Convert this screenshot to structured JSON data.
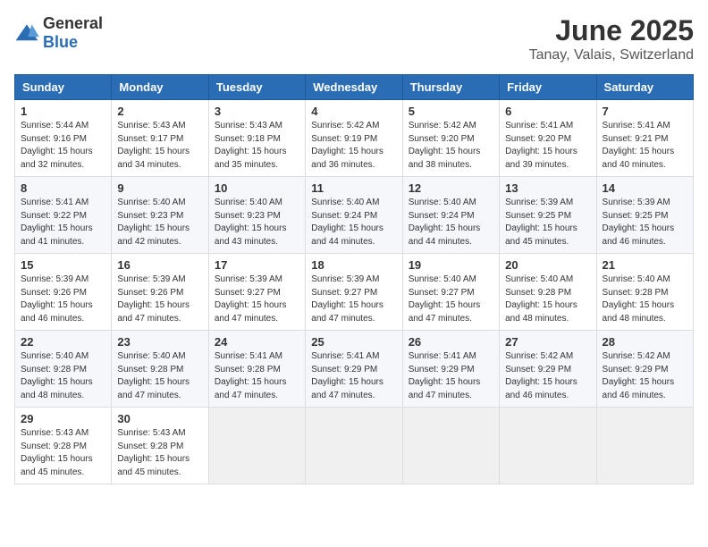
{
  "logo": {
    "text_general": "General",
    "text_blue": "Blue"
  },
  "title": "June 2025",
  "subtitle": "Tanay, Valais, Switzerland",
  "days_of_week": [
    "Sunday",
    "Monday",
    "Tuesday",
    "Wednesday",
    "Thursday",
    "Friday",
    "Saturday"
  ],
  "weeks": [
    [
      {
        "day": "1",
        "sunrise": "5:44 AM",
        "sunset": "9:16 PM",
        "daylight": "15 hours and 32 minutes."
      },
      {
        "day": "2",
        "sunrise": "5:43 AM",
        "sunset": "9:17 PM",
        "daylight": "15 hours and 34 minutes."
      },
      {
        "day": "3",
        "sunrise": "5:43 AM",
        "sunset": "9:18 PM",
        "daylight": "15 hours and 35 minutes."
      },
      {
        "day": "4",
        "sunrise": "5:42 AM",
        "sunset": "9:19 PM",
        "daylight": "15 hours and 36 minutes."
      },
      {
        "day": "5",
        "sunrise": "5:42 AM",
        "sunset": "9:20 PM",
        "daylight": "15 hours and 38 minutes."
      },
      {
        "day": "6",
        "sunrise": "5:41 AM",
        "sunset": "9:20 PM",
        "daylight": "15 hours and 39 minutes."
      },
      {
        "day": "7",
        "sunrise": "5:41 AM",
        "sunset": "9:21 PM",
        "daylight": "15 hours and 40 minutes."
      }
    ],
    [
      {
        "day": "8",
        "sunrise": "5:41 AM",
        "sunset": "9:22 PM",
        "daylight": "15 hours and 41 minutes."
      },
      {
        "day": "9",
        "sunrise": "5:40 AM",
        "sunset": "9:23 PM",
        "daylight": "15 hours and 42 minutes."
      },
      {
        "day": "10",
        "sunrise": "5:40 AM",
        "sunset": "9:23 PM",
        "daylight": "15 hours and 43 minutes."
      },
      {
        "day": "11",
        "sunrise": "5:40 AM",
        "sunset": "9:24 PM",
        "daylight": "15 hours and 44 minutes."
      },
      {
        "day": "12",
        "sunrise": "5:40 AM",
        "sunset": "9:24 PM",
        "daylight": "15 hours and 44 minutes."
      },
      {
        "day": "13",
        "sunrise": "5:39 AM",
        "sunset": "9:25 PM",
        "daylight": "15 hours and 45 minutes."
      },
      {
        "day": "14",
        "sunrise": "5:39 AM",
        "sunset": "9:25 PM",
        "daylight": "15 hours and 46 minutes."
      }
    ],
    [
      {
        "day": "15",
        "sunrise": "5:39 AM",
        "sunset": "9:26 PM",
        "daylight": "15 hours and 46 minutes."
      },
      {
        "day": "16",
        "sunrise": "5:39 AM",
        "sunset": "9:26 PM",
        "daylight": "15 hours and 47 minutes."
      },
      {
        "day": "17",
        "sunrise": "5:39 AM",
        "sunset": "9:27 PM",
        "daylight": "15 hours and 47 minutes."
      },
      {
        "day": "18",
        "sunrise": "5:39 AM",
        "sunset": "9:27 PM",
        "daylight": "15 hours and 47 minutes."
      },
      {
        "day": "19",
        "sunrise": "5:40 AM",
        "sunset": "9:27 PM",
        "daylight": "15 hours and 47 minutes."
      },
      {
        "day": "20",
        "sunrise": "5:40 AM",
        "sunset": "9:28 PM",
        "daylight": "15 hours and 48 minutes."
      },
      {
        "day": "21",
        "sunrise": "5:40 AM",
        "sunset": "9:28 PM",
        "daylight": "15 hours and 48 minutes."
      }
    ],
    [
      {
        "day": "22",
        "sunrise": "5:40 AM",
        "sunset": "9:28 PM",
        "daylight": "15 hours and 48 minutes."
      },
      {
        "day": "23",
        "sunrise": "5:40 AM",
        "sunset": "9:28 PM",
        "daylight": "15 hours and 47 minutes."
      },
      {
        "day": "24",
        "sunrise": "5:41 AM",
        "sunset": "9:28 PM",
        "daylight": "15 hours and 47 minutes."
      },
      {
        "day": "25",
        "sunrise": "5:41 AM",
        "sunset": "9:29 PM",
        "daylight": "15 hours and 47 minutes."
      },
      {
        "day": "26",
        "sunrise": "5:41 AM",
        "sunset": "9:29 PM",
        "daylight": "15 hours and 47 minutes."
      },
      {
        "day": "27",
        "sunrise": "5:42 AM",
        "sunset": "9:29 PM",
        "daylight": "15 hours and 46 minutes."
      },
      {
        "day": "28",
        "sunrise": "5:42 AM",
        "sunset": "9:29 PM",
        "daylight": "15 hours and 46 minutes."
      }
    ],
    [
      {
        "day": "29",
        "sunrise": "5:43 AM",
        "sunset": "9:28 PM",
        "daylight": "15 hours and 45 minutes."
      },
      {
        "day": "30",
        "sunrise": "5:43 AM",
        "sunset": "9:28 PM",
        "daylight": "15 hours and 45 minutes."
      },
      null,
      null,
      null,
      null,
      null
    ]
  ],
  "labels": {
    "sunrise": "Sunrise:",
    "sunset": "Sunset:",
    "daylight": "Daylight:"
  },
  "colors": {
    "header_bg": "#2a6db5"
  }
}
